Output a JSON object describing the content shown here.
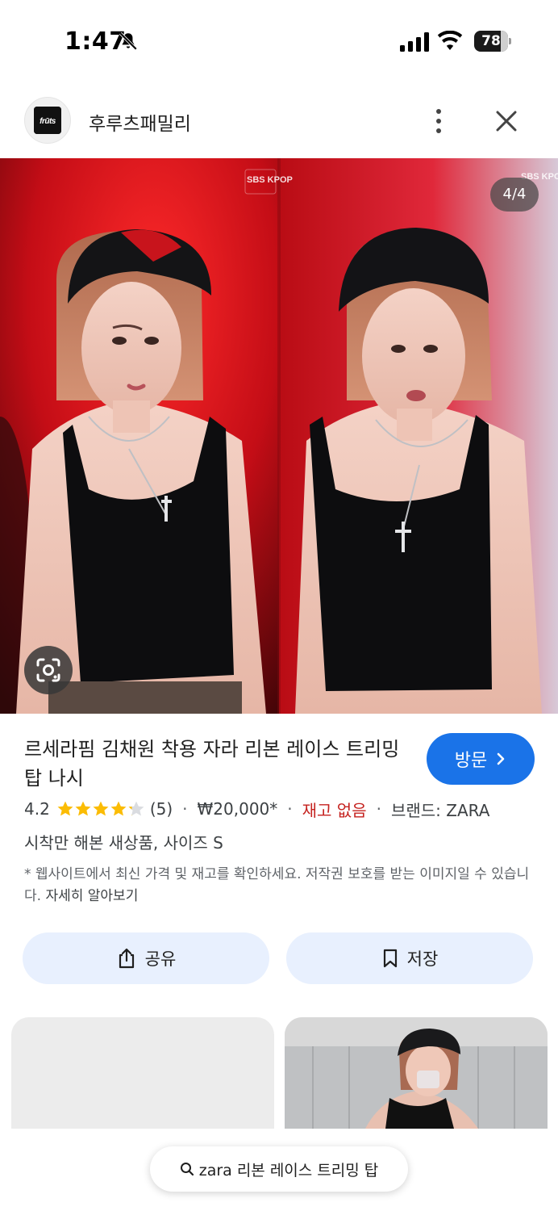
{
  "status_bar": {
    "time": "1:47",
    "battery": "78",
    "battery_level": 0.78
  },
  "header": {
    "site_name": "후루츠패밀리",
    "logo_text": "fruits"
  },
  "image": {
    "counter": "4/4",
    "watermark": "SBS KPOP"
  },
  "product": {
    "title": "르세라핌 김채원 착용 자라 리본 레이스 트리밍 탑 나시",
    "visit_label": "방문",
    "rating": "4.2",
    "rating_value": 4.2,
    "rating_max": 5,
    "review_count": "(5)",
    "price": "₩20,000*",
    "stock": "재고 없음",
    "brand": "브랜드: ZARA",
    "description": "시착만 해본 새상품, 사이즈 S",
    "disclaimer": "* 웹사이트에서 최신 가격 및 재고를 확인하세요. 저작권 보호를 받는 이미지일 수 있습니다.",
    "learn_more": "자세히 알아보기"
  },
  "actions": {
    "share_label": "공유",
    "save_label": "저장"
  },
  "search_chip": {
    "query": "zara 리본 레이스 트리밍 탑"
  },
  "colors": {
    "accent": "#1a73e8",
    "chip_bg": "#e8f0fe",
    "stock_red": "#c5221f",
    "star": "#fbbc04"
  },
  "icons": [
    "bell-off-icon",
    "signal-icon",
    "wifi-icon",
    "battery-icon",
    "more-vert-icon",
    "close-icon",
    "lens-icon",
    "chevron-right-icon",
    "star-icon",
    "share-icon",
    "bookmark-icon",
    "search-icon"
  ]
}
